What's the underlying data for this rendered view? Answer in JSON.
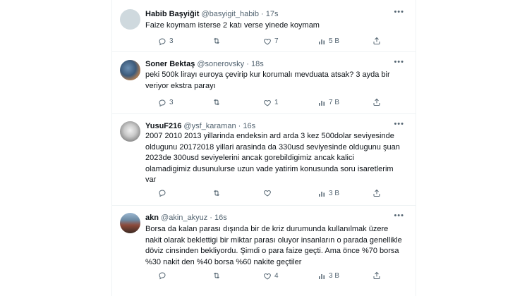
{
  "replies": [
    {
      "name": "Habib Başyiğit",
      "handle": "@basyigit_habib",
      "sep": "·",
      "time": "17s",
      "text": "Faize koymam isterse 2 katı verse yinede koymam",
      "counts": {
        "reply": "3",
        "retweet": "",
        "like": "7",
        "views": "5 B"
      }
    },
    {
      "name": "Soner Bektaş",
      "handle": "@sonerovsky",
      "sep": "·",
      "time": "18s",
      "text": "peki 500k lirayı euroya çevirip kur korumalı mevduata atsak? 3 ayda bir\nveriyor ekstra parayı",
      "counts": {
        "reply": "3",
        "retweet": "",
        "like": "1",
        "views": "7 B"
      }
    },
    {
      "name": "YusuF216",
      "handle": "@ysf_karaman",
      "sep": "·",
      "time": "16s",
      "text": "2007 2010 2013 yillarinda endeksin ard arda 3 kez 500dolar seviyesinde\noldugunu 20172018 yillari arasinda da 330usd seviyesinde oldugunu şuan\n2023de 300usd seviyelerini ancak gorebildigimiz ancak kalici\nolamadigimiz dusunulurse uzun vade yatirim konusunda soru isaretlerim\nvar",
      "counts": {
        "reply": "",
        "retweet": "",
        "like": "",
        "views": "3 B"
      }
    },
    {
      "name": "akn",
      "handle": "@akin_akyuz",
      "sep": "·",
      "time": "16s",
      "text": "Borsa da kalan parası dışında bir de kriz durumunda kullanılmak üzere\nnakit olarak beklettigi bir miktar parası oluyor insanların o parada genellikle\ndöviz cinsinden bekliyordu. Şimdi o para faize geçti. Ama önce %70 borsa\n%30 nakit den %40 borsa %60 nakite geçtiler",
      "counts": {
        "reply": "",
        "retweet": "",
        "like": "4",
        "views": "3 B"
      }
    }
  ],
  "icons": {
    "reply": "reply-icon",
    "retweet": "retweet-icon",
    "like": "heart-icon",
    "views": "views-icon",
    "share": "share-icon",
    "more": "more-icon"
  },
  "colors": {
    "text": "#0f1419",
    "muted": "#536471",
    "border": "#eff3f4"
  }
}
